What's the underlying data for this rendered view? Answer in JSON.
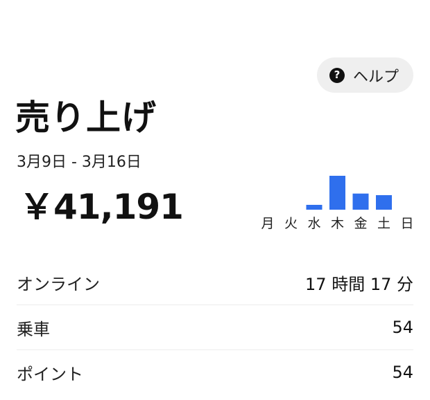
{
  "help": {
    "label": "ヘルプ",
    "icon": "help-circle-icon"
  },
  "header": {
    "title": "売り上げ",
    "date_range": "3月9日 - 3月16日",
    "total": "￥41,191"
  },
  "chart_data": {
    "type": "bar",
    "categories": [
      "月",
      "火",
      "水",
      "木",
      "金",
      "土",
      "日"
    ],
    "values": [
      0,
      0,
      3,
      21,
      10,
      9,
      0
    ],
    "ylim": [
      0,
      21
    ],
    "bar_color": "#2f6fed",
    "grid": false
  },
  "stats": [
    {
      "label": "オンライン",
      "value": "17 時間 17 分"
    },
    {
      "label": "乗車",
      "value": "54"
    },
    {
      "label": "ポイント",
      "value": "54"
    }
  ]
}
